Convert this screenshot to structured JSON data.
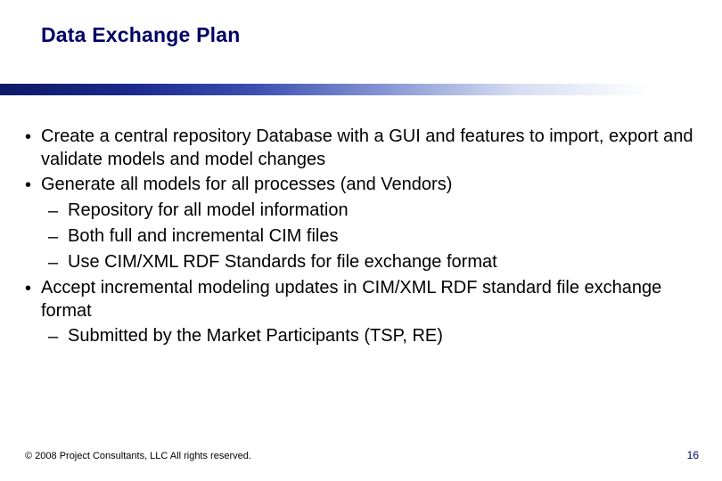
{
  "slide": {
    "title": "Data Exchange Plan",
    "bullets": [
      {
        "level": 1,
        "text": "Create a central repository Database with a GUI and features to import, export and validate models and model changes"
      },
      {
        "level": 1,
        "text": "Generate all models for all processes (and Vendors)"
      },
      {
        "level": 2,
        "text": "Repository for all model information"
      },
      {
        "level": 2,
        "text": "Both full and incremental CIM files"
      },
      {
        "level": 2,
        "text": "Use CIM/XML RDF Standards for file exchange format"
      },
      {
        "level": 1,
        "text": "Accept incremental modeling updates in CIM/XML RDF standard file exchange format"
      },
      {
        "level": 2,
        "text": "Submitted by the Market Participants (TSP, RE)"
      }
    ],
    "footer": {
      "copyright": "© 2008 Project Consultants, LLC All rights reserved.",
      "page_number": "16"
    },
    "marks": {
      "l1": "•",
      "l2": "–"
    }
  }
}
